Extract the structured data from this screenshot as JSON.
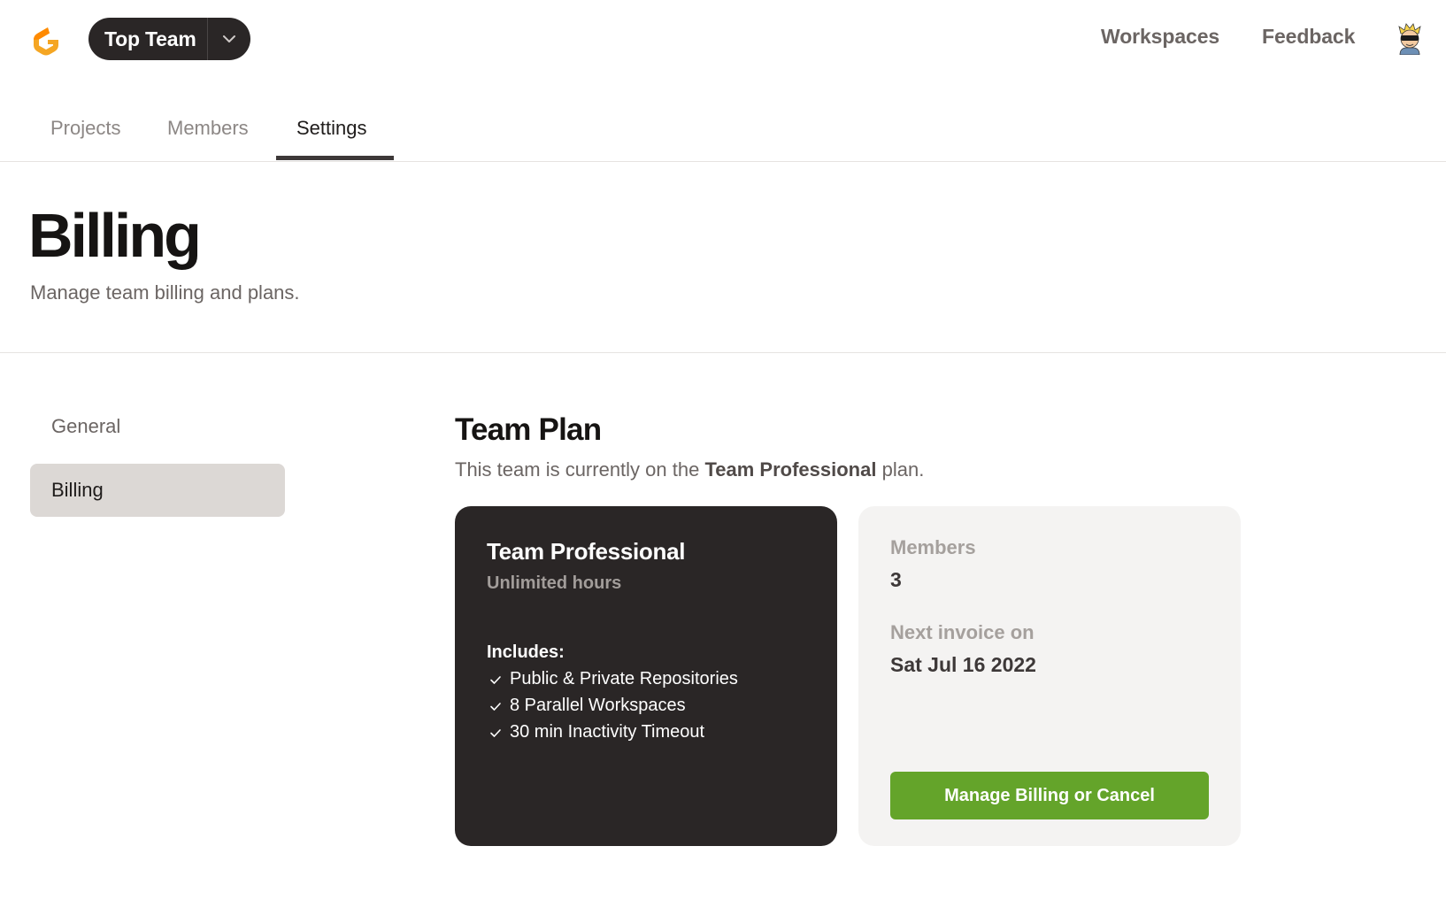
{
  "header": {
    "logo_icon": "gitpod-logo-icon",
    "team_name": "Top Team",
    "team_dropdown_icon": "chevron-down-icon",
    "nav_links": [
      "Workspaces",
      "Feedback"
    ],
    "avatar_icon": "user-avatar-icon"
  },
  "tabs": [
    {
      "label": "Projects",
      "active": false
    },
    {
      "label": "Members",
      "active": false
    },
    {
      "label": "Settings",
      "active": true
    }
  ],
  "page": {
    "title": "Billing",
    "subtitle": "Manage team billing and plans."
  },
  "sidebar": {
    "items": [
      {
        "label": "General",
        "active": false
      },
      {
        "label": "Billing",
        "active": true
      }
    ]
  },
  "plan": {
    "section_title": "Team Plan",
    "desc_prefix": "This team is currently on the",
    "desc_plan": "Team Professional",
    "desc_suffix": "plan.",
    "card": {
      "name": "Team Professional",
      "hours": "Unlimited hours",
      "includes_label": "Includes:",
      "features": [
        "Public & Private Repositories",
        "8 Parallel Workspaces",
        "30 min Inactivity Timeout"
      ]
    },
    "info": {
      "members_label": "Members",
      "members_value": "3",
      "invoice_label": "Next invoice on",
      "invoice_value": "Sat Jul 16 2022",
      "manage_button": "Manage Billing or Cancel"
    }
  },
  "colors": {
    "dark_card": "#2a2626",
    "accent_green": "#64a42a",
    "brand_orange": "#f5a623"
  }
}
